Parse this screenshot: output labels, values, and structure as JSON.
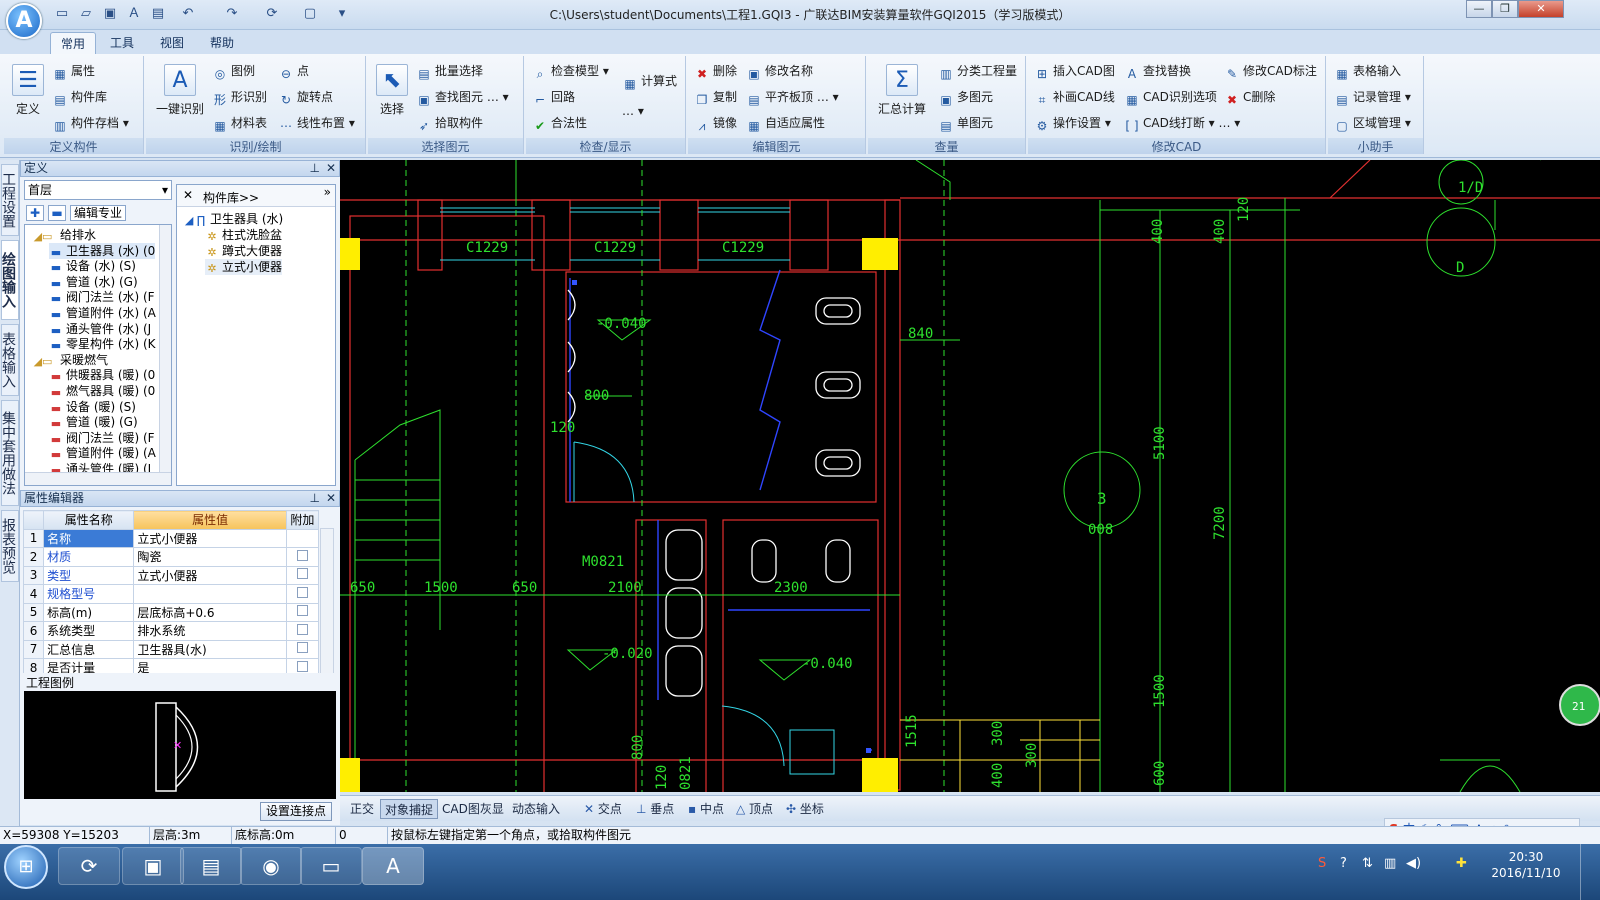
{
  "app": {
    "logo_letter": "A",
    "window_title": "C:\\Users\\student\\Documents\\工程1.GQI3 - 广联达BIM安装算量软件GQI2015（学习版模式）"
  },
  "quick_access": [
    "new-file-icon",
    "open-folder-icon",
    "save-icon",
    "text-a-icon",
    "image-icon",
    "undo-icon",
    "redo-icon",
    "refresh-icon",
    "window-icon",
    "dropdown-icon"
  ],
  "menu_tabs": [
    "常用",
    "工具",
    "视图",
    "帮助"
  ],
  "ribbon": {
    "groups": [
      {
        "title": "定义构件",
        "big": "定义",
        "items": [
          "属性",
          "构件库",
          "构件存档"
        ]
      },
      {
        "title": "识别/绘制",
        "big": "一键识别",
        "items": [
          "图例",
          "点",
          "形识别",
          "旋转点",
          "材料表",
          "线性布置"
        ]
      },
      {
        "title": "选择图元",
        "big": "选择",
        "items": [
          "批量选择",
          "查找图元",
          "拾取构件"
        ]
      },
      {
        "title": "检查/显示",
        "items": [
          "检查模型",
          "计算式",
          "回路",
          "合法性"
        ]
      },
      {
        "title": "编辑图元",
        "items": [
          "删除",
          "修改名称",
          "复制",
          "平齐板顶",
          "镜像",
          "自适应属性"
        ]
      },
      {
        "title": "查量",
        "big": "汇总计算",
        "items": [
          "分类工程量",
          "多图元",
          "单图元"
        ]
      },
      {
        "title": "修改CAD",
        "items": [
          "插入CAD图",
          "查找替换",
          "修改CAD标注",
          "补画CAD线",
          "CAD识别选项",
          "C删除",
          "操作设置",
          "CAD线打断"
        ]
      },
      {
        "title": "小助手",
        "items": [
          "表格输入",
          "记录管理",
          "区域管理"
        ]
      }
    ]
  },
  "vertical_tabs": [
    "工程设置",
    "绘图输入",
    "表格输入",
    "集中套用做法",
    "报表预览"
  ],
  "definition_panel": {
    "title": "定义",
    "floor": "首层",
    "specialty_button": "编辑专业",
    "tree": [
      {
        "label": "给排水",
        "level": 0
      },
      {
        "label": "卫生器具 (水) (0",
        "level": 1
      },
      {
        "label": "设备 (水) (S)",
        "level": 1
      },
      {
        "label": "管道 (水) (G)",
        "level": 1
      },
      {
        "label": "阀门法兰 (水) (F",
        "level": 1
      },
      {
        "label": "管道附件 (水) (A",
        "level": 1
      },
      {
        "label": "通头管件 (水) (J",
        "level": 1
      },
      {
        "label": "零星构件 (水) (K",
        "level": 1
      },
      {
        "label": "采暖燃气",
        "level": 0
      },
      {
        "label": "供暖器具 (暖) (0",
        "level": 1
      },
      {
        "label": "燃气器具 (暖) (0",
        "level": 1
      },
      {
        "label": "设备 (暖) (S)",
        "level": 1
      },
      {
        "label": "管道 (暖) (G)",
        "level": 1
      },
      {
        "label": "阀门法兰 (暖) (F",
        "level": 1
      },
      {
        "label": "管道附件 (暖) (A",
        "level": 1
      },
      {
        "label": "通头管件 (暖) (J",
        "level": 1
      }
    ],
    "library_title": "构件库>>",
    "library_tree": [
      {
        "label": "卫生器具 (水)",
        "level": 0
      },
      {
        "label": "柱式洗脸盆",
        "level": 1
      },
      {
        "label": "蹲式大便器",
        "level": 1
      },
      {
        "label": "立式小便器",
        "level": 1
      }
    ]
  },
  "property_editor": {
    "title": "属性编辑器",
    "headers": [
      "属性名称",
      "属性值",
      "附加"
    ],
    "rows": [
      {
        "n": "1",
        "name": "名称",
        "value": "立式小便器",
        "blue": true
      },
      {
        "n": "2",
        "name": "材质",
        "value": "陶瓷",
        "blue": true
      },
      {
        "n": "3",
        "name": "类型",
        "value": "立式小便器",
        "blue": true
      },
      {
        "n": "4",
        "name": "规格型号",
        "value": "",
        "blue": true
      },
      {
        "n": "5",
        "name": "标高(m)",
        "value": "层底标高+0.6",
        "blue": false
      },
      {
        "n": "6",
        "name": "系统类型",
        "value": "排水系统",
        "blue": false
      },
      {
        "n": "7",
        "name": "汇总信息",
        "value": "卫生器具(水)",
        "blue": false
      },
      {
        "n": "8",
        "name": "是否计量",
        "value": "是",
        "blue": false
      }
    ]
  },
  "preview": {
    "title": "工程图例",
    "button": "设置连接点"
  },
  "cad_labels": {
    "windows": [
      "C1229",
      "C1229",
      "C1229"
    ],
    "door": "M0821",
    "dims": [
      "840",
      "800",
      "120",
      "650",
      "1500",
      "650",
      "2100",
      "2300",
      "400",
      "400",
      "120",
      "5100",
      "7200",
      "1500",
      "600",
      "800",
      "120",
      "0821",
      "300",
      "300",
      "400",
      "1515"
    ],
    "levels": [
      "-0.040",
      "-0.020",
      "-0.040"
    ],
    "axis": [
      "1/D",
      "D",
      "3",
      "008"
    ],
    "badge": "21"
  },
  "snapbar": [
    "正交",
    "对象捕捉",
    "CAD图灰显",
    "动态输入",
    "交点",
    "垂点",
    "中点",
    "顶点",
    "坐标"
  ],
  "statusbar": {
    "coords": "X=59308 Y=15203",
    "floor_height": "层高:3m",
    "base_height": "底标高:0m",
    "count": "0",
    "hint": "按鼠标左键指定第一个角点，或拾取构件图元"
  },
  "ime": {
    "label": "中"
  },
  "taskbar": {
    "time": "20:30",
    "date": "2016/11/10"
  }
}
